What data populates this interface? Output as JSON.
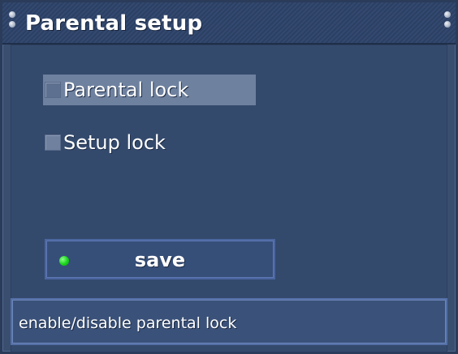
{
  "window": {
    "title": "Parental setup"
  },
  "options": [
    {
      "label": "Parental lock",
      "checked": false,
      "selected": true
    },
    {
      "label": "Setup lock",
      "checked": false,
      "selected": false
    }
  ],
  "actions": {
    "save_label": "save",
    "save_indicator_color": "#22dd22"
  },
  "status": {
    "help_text": "enable/disable parental lock"
  },
  "theme": {
    "background": "#3a4f70",
    "accent": "#4c66a1"
  }
}
